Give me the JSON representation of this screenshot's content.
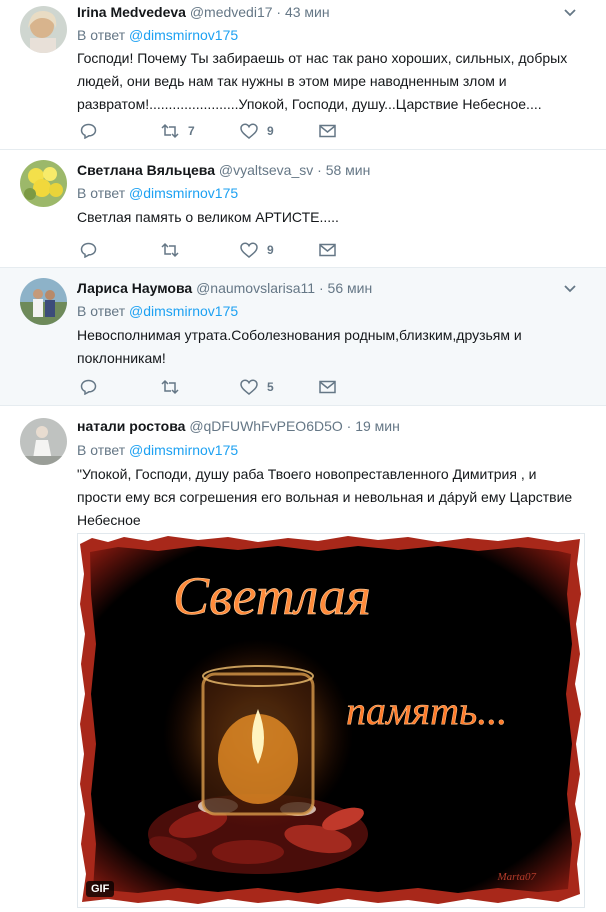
{
  "tweets": [
    {
      "name": "Irina Medvedeva",
      "handle": "@medvedi17",
      "time": "· 43 мин",
      "reply_prefix": "В ответ",
      "reply_to": "@dimsmirnov175",
      "text_lines": [
        "Господи! Почему Ты забираешь от нас так рано хороших, сильных, добрых",
        "людей, они ведь нам так нужны в этом мире наводненным злом и",
        "развратом!.......................Упокой, Господи, душу...Царствие Небесное...."
      ],
      "retweets": "7",
      "likes": "9"
    },
    {
      "name": "Светлана Вяльцева",
      "handle": "@vyaltseva_sv",
      "time": "· 58 мин",
      "reply_prefix": "В ответ",
      "reply_to": "@dimsmirnov175",
      "text_lines": [
        "Светлая память о великом АРТИСТЕ....."
      ],
      "retweets": "",
      "likes": "9"
    },
    {
      "name": "Лариса Наумова",
      "handle": "@naumovslarisa11",
      "time": "· 56 мин",
      "reply_prefix": "В ответ",
      "reply_to": "@dimsmirnov175",
      "text_lines": [
        "Невосполнимая утрата.Соболезнования родным,близким,друзьям и",
        "поклонникам!"
      ],
      "retweets": "",
      "likes": "5"
    },
    {
      "name": "натали ростова",
      "handle": "@qDFUWhFvPEO6D5O",
      "time": "· 19 мин",
      "reply_prefix": "В ответ",
      "reply_to": "@dimsmirnov175",
      "text_lines": [
        "\"Упокой, Господи, душу раба Твоего новопреставленного Димитрия , и",
        "прости ему вся согрешения его вольная и невольная и да́руй ему Царствие",
        "Небесное"
      ]
    }
  ],
  "media": {
    "line1": "Светлая",
    "line2": "память...",
    "badge": "GIF",
    "watermark": "Marta07"
  },
  "colors": {
    "link": "#1da1f2",
    "muted": "#657786",
    "text": "#14171a",
    "highlight_bg": "#f5f8fa"
  },
  "icons": [
    "reply-icon",
    "retweet-icon",
    "like-icon",
    "message-icon",
    "chevron-down-icon",
    "gif-badge"
  ]
}
